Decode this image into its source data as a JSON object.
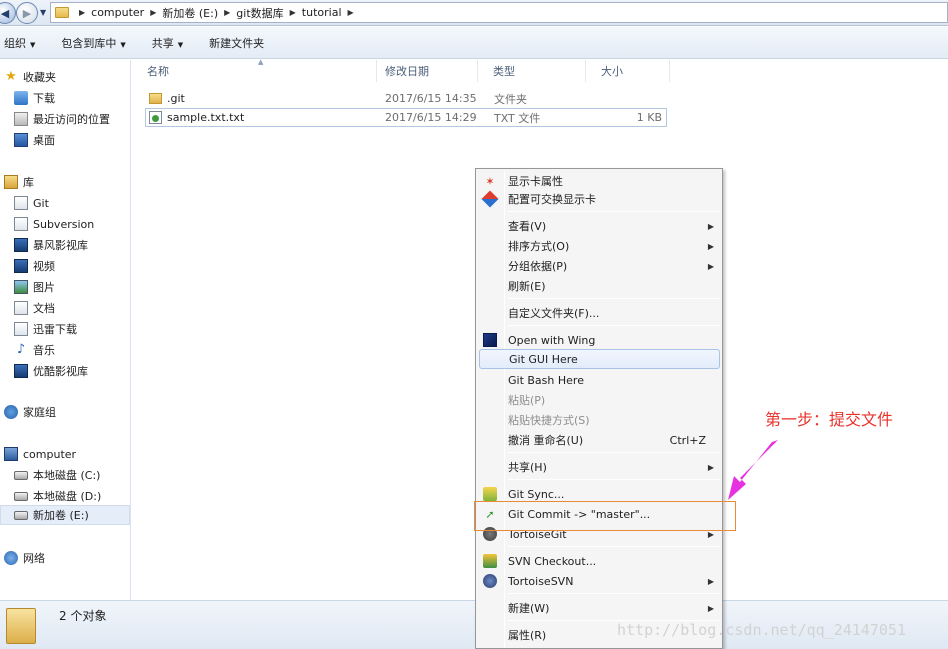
{
  "address": {
    "crumbs": [
      "computer",
      "新加卷 (E:)",
      "git数据库",
      "tutorial"
    ]
  },
  "toolbar": {
    "items": [
      "组织",
      "包含到库中",
      "共享",
      "新建文件夹"
    ]
  },
  "sidebar": {
    "favorites": {
      "label": "收藏夹",
      "items": [
        "下载",
        "最近访问的位置",
        "桌面"
      ]
    },
    "libraries": {
      "label": "库",
      "items": [
        "Git",
        "Subversion",
        "暴风影视库",
        "视频",
        "图片",
        "文档",
        "迅雷下载",
        "音乐",
        "优酷影视库"
      ]
    },
    "homegroup": "家庭组",
    "computer": {
      "label": "computer",
      "items": [
        "本地磁盘 (C:)",
        "本地磁盘 (D:)",
        "新加卷 (E:)"
      ]
    },
    "network": "网络"
  },
  "columns": [
    "名称",
    "修改日期",
    "类型",
    "大小"
  ],
  "files": [
    {
      "name": ".git",
      "date": "2017/6/15 14:35",
      "type": "文件夹",
      "size": ""
    },
    {
      "name": "sample.txt.txt",
      "date": "2017/6/15 14:29",
      "type": "TXT 文件",
      "size": "1 KB"
    }
  ],
  "status": {
    "count_text": "2 个对象"
  },
  "context_menu": {
    "items": [
      {
        "label": "显示卡属性"
      },
      {
        "label": "配置可交换显示卡"
      },
      {
        "label": "查看(V)",
        "submenu": true
      },
      {
        "label": "排序方式(O)",
        "submenu": true
      },
      {
        "label": "分组依据(P)",
        "submenu": true
      },
      {
        "label": "刷新(E)"
      },
      {
        "label": "自定义文件夹(F)..."
      },
      {
        "label": "Open with Wing"
      },
      {
        "label": "Git GUI Here",
        "highlighted": true
      },
      {
        "label": "Git Bash Here"
      },
      {
        "label": "粘贴(P)",
        "disabled": true
      },
      {
        "label": "粘贴快捷方式(S)",
        "disabled": true
      },
      {
        "label": "撤消 重命名(U)",
        "shortcut": "Ctrl+Z"
      },
      {
        "label": "共享(H)",
        "submenu": true
      },
      {
        "label": "Git Sync..."
      },
      {
        "label": "Git Commit -> \"master\"..."
      },
      {
        "label": "TortoiseGit",
        "submenu": true
      },
      {
        "label": "SVN Checkout..."
      },
      {
        "label": "TortoiseSVN",
        "submenu": true
      },
      {
        "label": "新建(W)",
        "submenu": true
      },
      {
        "label": "属性(R)"
      }
    ]
  },
  "annotation": {
    "text": "第一步：提交文件",
    "color": "#e8322c",
    "arrow_color": "#e632e0"
  },
  "watermark": "http://blog.csdn.net/qq_24147051",
  "icons": {
    "back": "back-arrow-icon",
    "forward": "forward-arrow-icon",
    "submenu": "chevron-right-icon"
  }
}
